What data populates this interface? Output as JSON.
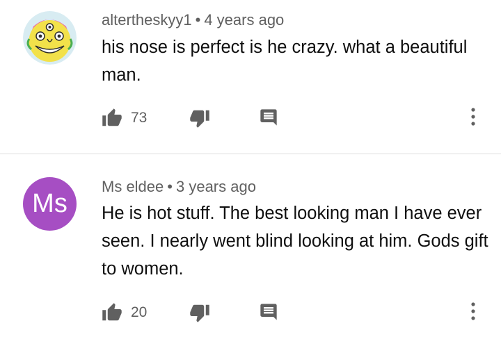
{
  "comments": [
    {
      "author": "altertheskyy1",
      "separator": "•",
      "time": "4 years ago",
      "text": "his nose is perfect is he crazy. what a beautiful man.",
      "likes": "73",
      "avatar": {
        "type": "image",
        "icon": "cartoon-face-avatar"
      }
    },
    {
      "author": "Ms eldee",
      "separator": "•",
      "time": "3 years ago",
      "text": "He is hot stuff. The best looking man I have ever seen. I nearly went blind looking at him. Gods gift to women.",
      "likes": "20",
      "avatar": {
        "type": "initials",
        "initials": "Ms",
        "color": "#a64ec3"
      }
    }
  ],
  "colors": {
    "icon": "#606060",
    "meta_text": "#606060",
    "body_text": "#0f0f0f",
    "divider": "#dcdcdc"
  }
}
